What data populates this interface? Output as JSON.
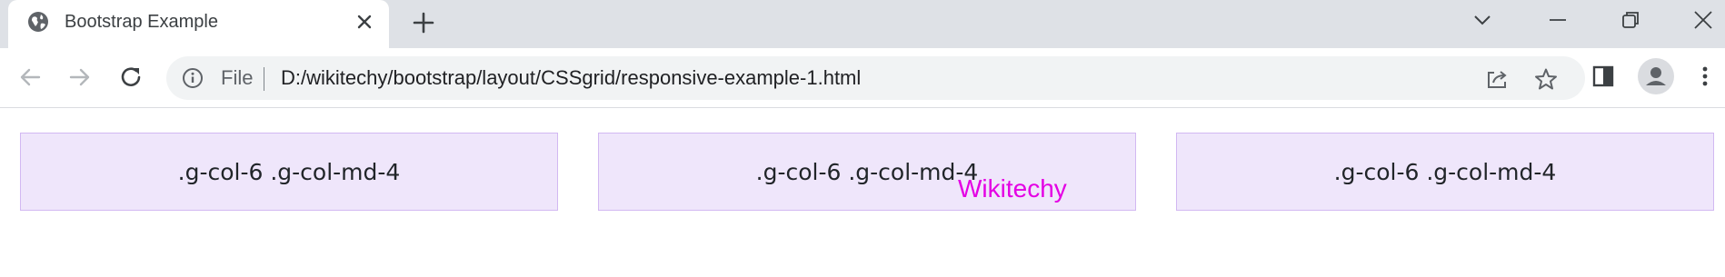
{
  "browser": {
    "tab": {
      "title": "Bootstrap Example",
      "favicon": "globe-icon"
    },
    "new_tab_icon": "plus-icon",
    "window_controls": [
      "chevron-down-icon",
      "minimize-icon",
      "restore-icon",
      "close-icon"
    ],
    "toolbar": {
      "back_icon": "arrow-left-icon",
      "forward_icon": "arrow-right-icon",
      "reload_icon": "reload-icon",
      "site_info_icon": "info-icon",
      "scheme_label": "File",
      "url": "D:/wikitechy/bootstrap/layout/CSSgrid/responsive-example-1.html",
      "share_icon": "share-icon",
      "bookmark_icon": "star-icon",
      "side_panel_icon": "side-panel-icon",
      "profile_icon": "person-icon",
      "menu_icon": "kebab-menu-icon"
    }
  },
  "page": {
    "grid_items": [
      {
        "label": ".g-col-6 .g-col-md-4"
      },
      {
        "label": ".g-col-6 .g-col-md-4"
      },
      {
        "label": ".g-col-6 .g-col-md-4"
      }
    ],
    "watermark": "Wikitechy"
  },
  "colors": {
    "tabstrip_bg": "#dee1e6",
    "grid_item_bg": "#efe6fb",
    "grid_item_border": "#d2b8f2",
    "watermark": "#e400e4"
  }
}
